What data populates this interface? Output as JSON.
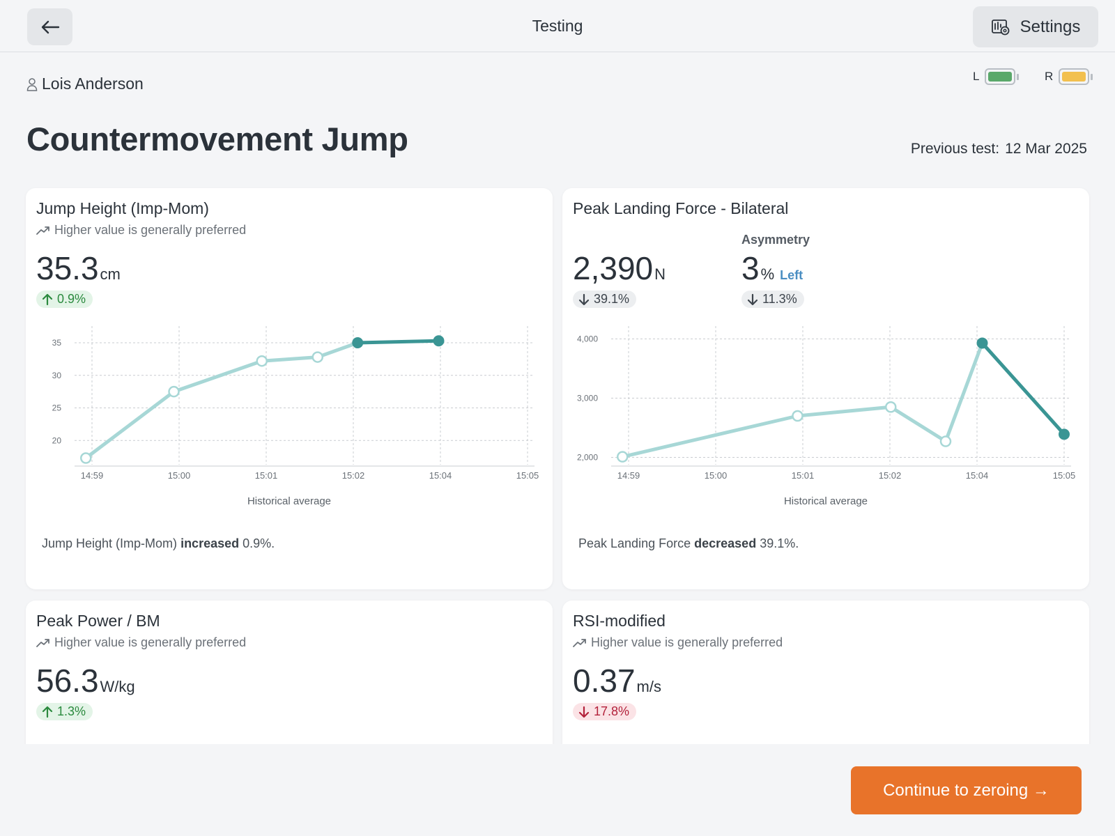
{
  "topbar": {
    "title": "Testing",
    "settings_label": "Settings"
  },
  "athlete": {
    "name": "Lois Anderson"
  },
  "devices": [
    {
      "label": "L",
      "color": "#5aa86a"
    },
    {
      "label": "R",
      "color": "#f2c04f"
    }
  ],
  "test": {
    "title": "Countermovement Jump",
    "previous_label": "Previous test:",
    "previous_date": "12 Mar 2025"
  },
  "colors": {
    "accent": "#e8732a",
    "line_light": "#a7d7d6",
    "line_dark": "#3a9594",
    "up": "#2b8a3e",
    "down": "#b3223b",
    "link": "#4a8ec2"
  },
  "cards": [
    {
      "title": "Jump Height (Imp-Mom)",
      "preference": "Higher value is generally preferred",
      "value": "35.3",
      "unit": "cm",
      "change": "0.9%",
      "change_dir": "up",
      "summary_metric": "Jump Height (Imp-Mom)",
      "summary_verb": "increased",
      "summary_value": "0.9%."
    },
    {
      "title": "Peak Landing Force - Bilateral",
      "value": "2,390",
      "unit": "N",
      "change": "39.1%",
      "change_dir": "down",
      "asym_label": "Asymmetry",
      "asym_value": "3",
      "asym_unit": "%",
      "asym_side": "Left",
      "asym_change": "11.3%",
      "summary_metric": "Peak Landing Force",
      "summary_verb": "decreased",
      "summary_value": "39.1%."
    },
    {
      "title": "Peak Power / BM",
      "preference": "Higher value is generally preferred",
      "value": "56.3",
      "unit": "W/kg",
      "change": "1.3%",
      "change_dir": "up"
    },
    {
      "title": "RSI-modified",
      "preference": "Higher value is generally preferred",
      "value": "0.37",
      "unit": "m/s",
      "change": "17.8%",
      "change_dir": "down"
    }
  ],
  "chart_data": [
    {
      "type": "line",
      "xlabel": "Historical average",
      "x_ticks": [
        "14:59",
        "15:00",
        "15:01",
        "15:02",
        "15:04",
        "15:05"
      ],
      "y_ticks": [
        "35",
        "30",
        "25",
        "20"
      ],
      "ylim": [
        16.5,
        36.5
      ],
      "x_minutes": [
        -0.07,
        0.94,
        1.95,
        2.59,
        3.05,
        3.98
      ],
      "values": [
        17.3,
        27.5,
        32.2,
        32.8,
        35.0,
        35.3
      ],
      "current_from_index": 4
    },
    {
      "type": "line",
      "xlabel": "Historical average",
      "x_ticks": [
        "14:59",
        "15:00",
        "15:01",
        "15:02",
        "15:04",
        "15:05"
      ],
      "y_ticks": [
        "4,000",
        "3,000",
        "2,000"
      ],
      "ylim": [
        1900,
        4100
      ],
      "x_minutes": [
        -0.07,
        1.94,
        3.01,
        3.64,
        4.06,
        5.0
      ],
      "values": [
        2010,
        2700,
        2850,
        2270,
        3930,
        2390
      ],
      "current_from_index": 4
    }
  ],
  "footer": {
    "continue_label": "Continue to zeroing →"
  }
}
